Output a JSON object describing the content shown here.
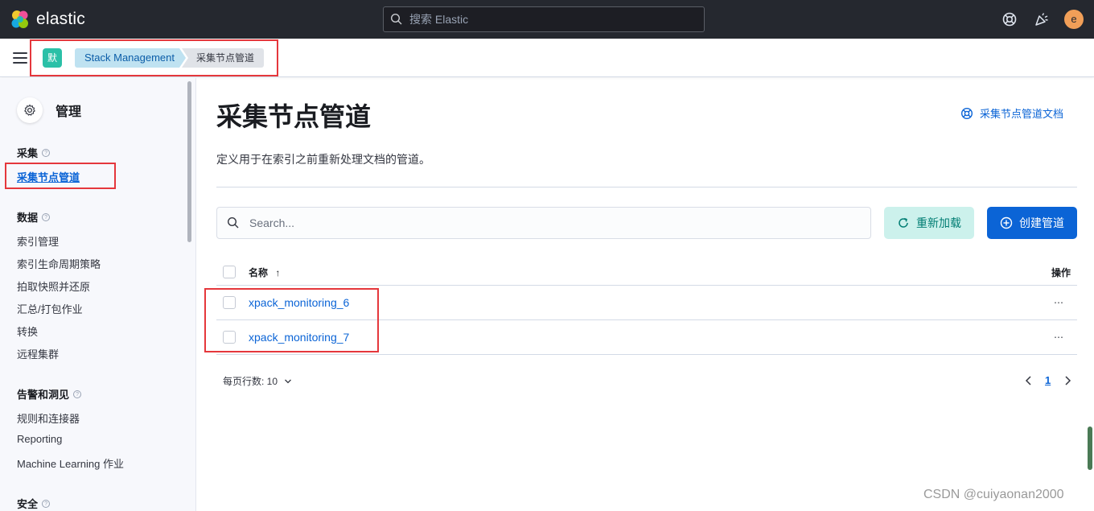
{
  "header": {
    "logo_text": "elastic",
    "search_placeholder": "搜索 Elastic",
    "avatar_initial": "e"
  },
  "breadcrumbs": {
    "space_badge": "默",
    "items": [
      "Stack Management",
      "采集节点管道"
    ]
  },
  "sidebar": {
    "title": "管理",
    "groups": [
      {
        "label": "采集",
        "items": [
          "采集节点管道"
        ]
      },
      {
        "label": "数据",
        "items": [
          "索引管理",
          "索引生命周期策略",
          "拍取快照并还原",
          "汇总/打包作业",
          "转换",
          "远程集群"
        ]
      },
      {
        "label": "告警和洞见",
        "items": [
          "规则和连接器",
          "Reporting",
          "Machine Learning 作业"
        ]
      },
      {
        "label": "安全",
        "items": []
      }
    ]
  },
  "main": {
    "title": "采集节点管道",
    "doc_link": "采集节点管道文档",
    "description": "定义用于在索引之前重新处理文档的管道。",
    "search_placeholder": "Search...",
    "reload_button": "重新加载",
    "create_button": "创建管道",
    "table": {
      "col_name": "名称",
      "sort_indicator": "↑",
      "col_actions": "操作",
      "rows": [
        {
          "name": "xpack_monitoring_6",
          "actions": "⋯"
        },
        {
          "name": "xpack_monitoring_7",
          "actions": "⋯"
        }
      ]
    },
    "pagination": {
      "rows_per_page": "每页行数: 10",
      "current_page": "1"
    }
  },
  "watermark": "CSDN @cuiyaonan2000",
  "colors": {
    "header_bg": "#25282f",
    "accent": "#0b64d6",
    "reload_bg": "#ccf1ec",
    "highlight_red": "#e5373c"
  }
}
